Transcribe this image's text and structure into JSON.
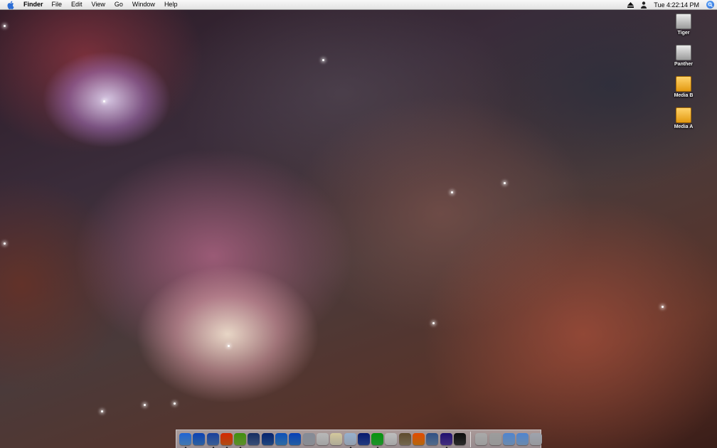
{
  "menubar": {
    "app_name": "Finder",
    "menus": [
      "File",
      "Edit",
      "View",
      "Go",
      "Window",
      "Help"
    ],
    "clock": "Tue 4:22:14 PM",
    "status_icons": [
      "eject-icon",
      "user-icon"
    ]
  },
  "desktop_icons": [
    {
      "label": "Tiger",
      "icon": "hard-drive-icon"
    },
    {
      "label": "Panther",
      "icon": "hard-drive-icon"
    },
    {
      "label": "Media B",
      "icon": "external-drive-icon"
    },
    {
      "label": "Media A",
      "icon": "external-drive-icon"
    }
  ],
  "dock": {
    "apps": [
      {
        "icon": "finder-icon",
        "color": "#5aa0e8",
        "running": true
      },
      {
        "icon": "safari-icon",
        "color": "#3b82d6",
        "running": false
      },
      {
        "icon": "preview-icon",
        "color": "#4f7fc7",
        "running": true
      },
      {
        "icon": "firefox-icon",
        "color": "#e8661c",
        "running": true
      },
      {
        "icon": "itunes-icon",
        "color": "#7fbf3c",
        "running": true
      },
      {
        "icon": "iphoto-icon",
        "color": "#4c6a9e",
        "running": false
      },
      {
        "icon": "imovie-icon",
        "color": "#2a5ea8",
        "running": false
      },
      {
        "icon": "mail-icon",
        "color": "#3d8fd9",
        "running": false
      },
      {
        "icon": "quicktime-icon",
        "color": "#2f7fd8",
        "running": false
      },
      {
        "icon": "printer-icon",
        "color": "#b8bcc4",
        "running": false
      },
      {
        "icon": "clapper-icon",
        "color": "#d9d9d9",
        "running": false
      },
      {
        "icon": "textedit-icon",
        "color": "#e8e2c8",
        "running": false
      },
      {
        "icon": "pen-icon",
        "color": "#c4d4e6",
        "running": true
      },
      {
        "icon": "network-icon",
        "color": "#2e4fa8",
        "running": false
      },
      {
        "icon": "activity-monitor-icon",
        "color": "#29c23a",
        "running": true
      },
      {
        "icon": "ipod-icon",
        "color": "#dcdcdc",
        "running": false
      },
      {
        "icon": "script-editor-icon",
        "color": "#9b8a6a",
        "running": false
      },
      {
        "icon": "vlc-icon",
        "color": "#f08a14",
        "running": false
      },
      {
        "icon": "disk-utility-icon",
        "color": "#6f8fb8",
        "running": false
      },
      {
        "icon": "audio-icon",
        "color": "#5a3fa8",
        "running": true
      },
      {
        "icon": "x11-icon",
        "color": "#3a3a3a",
        "running": false
      }
    ],
    "docklets": [
      {
        "icon": "network-server-icon",
        "color": "#d0d0d0"
      },
      {
        "icon": "network-server-icon",
        "color": "#c8c8c8"
      },
      {
        "icon": "folder-icon",
        "color": "#8fb8e6"
      },
      {
        "icon": "applications-folder-icon",
        "color": "#8fb8e6"
      },
      {
        "icon": "trash-icon",
        "color": "#c9ccd2"
      }
    ]
  },
  "colors": {
    "menubar_bg": "#eeeeee",
    "spotlight_accent": "#1d5fd0"
  }
}
